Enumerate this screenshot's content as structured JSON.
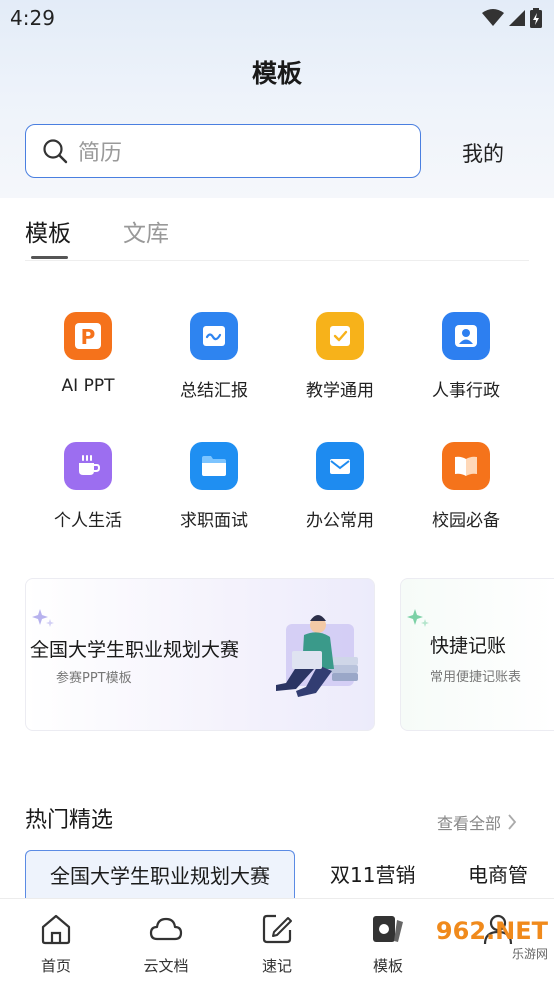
{
  "status_bar": {
    "time": "4:29"
  },
  "header": {
    "title": "模板"
  },
  "search": {
    "placeholder": "简历",
    "mine_label": "我的"
  },
  "tabs": [
    {
      "label": "模板",
      "active": true
    },
    {
      "label": "文库",
      "active": false
    }
  ],
  "categories": [
    {
      "label": "AI PPT",
      "icon": "ppt-icon",
      "color": "#f5721b"
    },
    {
      "label": "总结汇报",
      "icon": "report-icon",
      "color": "#2e84f0"
    },
    {
      "label": "教学通用",
      "icon": "teaching-icon",
      "color": "#f7b21a"
    },
    {
      "label": "人事行政",
      "icon": "hr-icon",
      "color": "#2d7ff0"
    },
    {
      "label": "个人生活",
      "icon": "coffee-icon",
      "color": "#9c6ef0"
    },
    {
      "label": "求职面试",
      "icon": "folder-icon",
      "color": "#1f8ff2"
    },
    {
      "label": "办公常用",
      "icon": "mail-icon",
      "color": "#1e8bf0"
    },
    {
      "label": "校园必备",
      "icon": "book-icon",
      "color": "#f5731b"
    }
  ],
  "banners": [
    {
      "title": "全国大学生职业规划大赛",
      "subtitle": "参赛PPT模板"
    },
    {
      "title": "快捷记账",
      "subtitle": "常用便捷记账表"
    }
  ],
  "hot_section": {
    "title": "热门精选",
    "view_all": "查看全部"
  },
  "chips": [
    {
      "label": "全国大学生职业规划大赛",
      "active": true
    },
    {
      "label": "双11营销",
      "active": false
    },
    {
      "label": "电商管",
      "active": false
    }
  ],
  "bottom_nav": [
    {
      "label": "首页",
      "icon": "home-icon"
    },
    {
      "label": "云文档",
      "icon": "cloud-icon"
    },
    {
      "label": "速记",
      "icon": "note-edit-icon"
    },
    {
      "label": "模板",
      "icon": "template-icon"
    }
  ],
  "watermark": {
    "main": "962.NET",
    "sub": "乐游网"
  },
  "colors": {
    "accent": "#4a7fe0",
    "chip_bg": "#eef3fc"
  }
}
